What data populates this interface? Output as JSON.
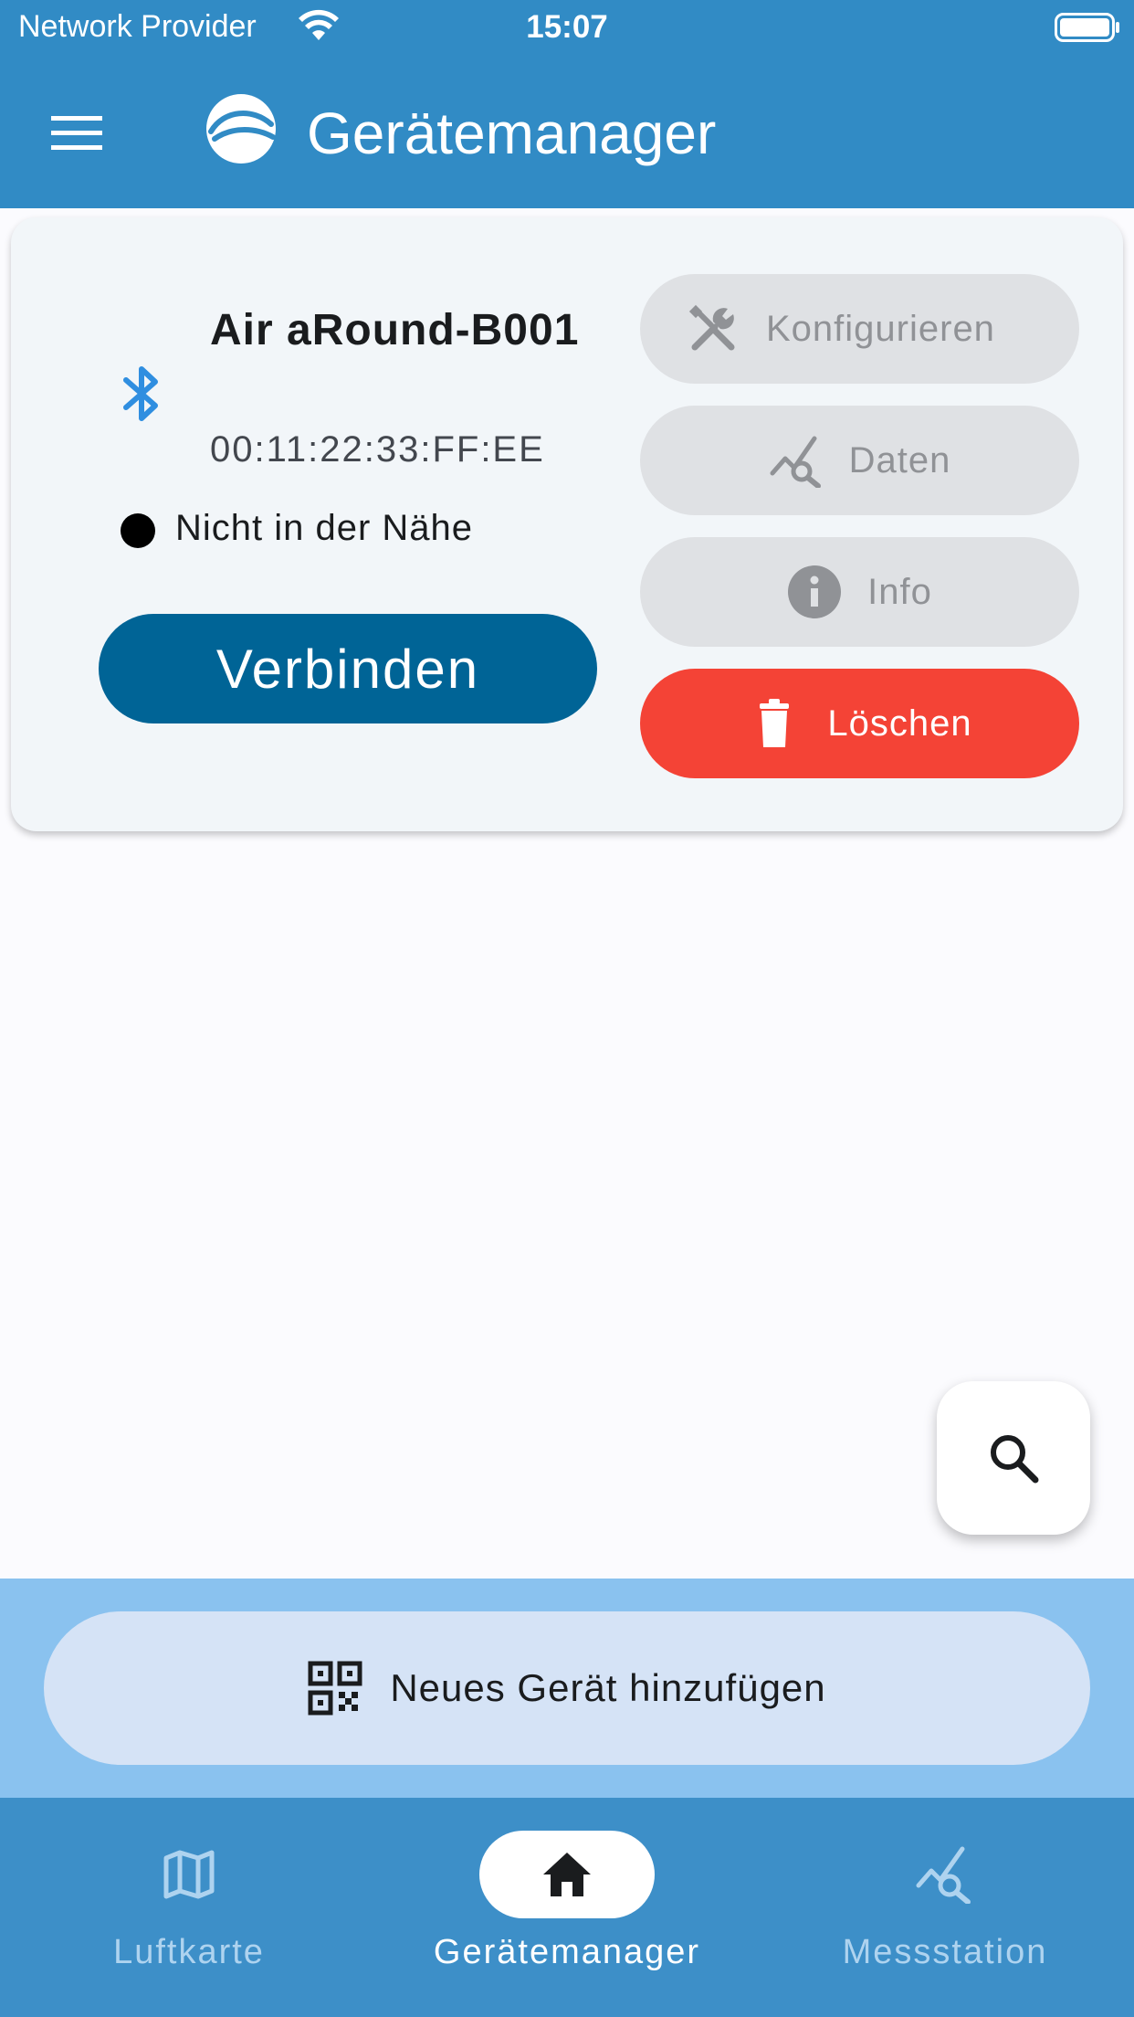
{
  "status_bar": {
    "carrier": "Network Provider",
    "time": "15:07"
  },
  "app_bar": {
    "title": "Gerätemanager"
  },
  "device_card": {
    "name": "Air aRound-B001",
    "mac": "00:11:22:33:FF:EE",
    "proximity": "Nicht in der Nähe",
    "connect_label": "Verbinden",
    "actions": {
      "configure": "Konfigurieren",
      "data": "Daten",
      "info": "Info",
      "delete": "Löschen"
    }
  },
  "add_device": {
    "label": "Neues Gerät hinzufügen"
  },
  "bottom_nav": {
    "items": [
      {
        "label": "Luftkarte",
        "icon": "map-icon"
      },
      {
        "label": "Gerätemanager",
        "icon": "home-icon"
      },
      {
        "label": "Messstation",
        "icon": "chart-search-icon"
      }
    ],
    "active_index": 1
  },
  "colors": {
    "app_bar": "#318bc5",
    "connect_button": "#006496",
    "delete_button": "#f44336",
    "bluetooth_icon": "#2f8ee0",
    "add_area": "#8ac2ef",
    "bottom_nav": "#3d8fc8"
  }
}
